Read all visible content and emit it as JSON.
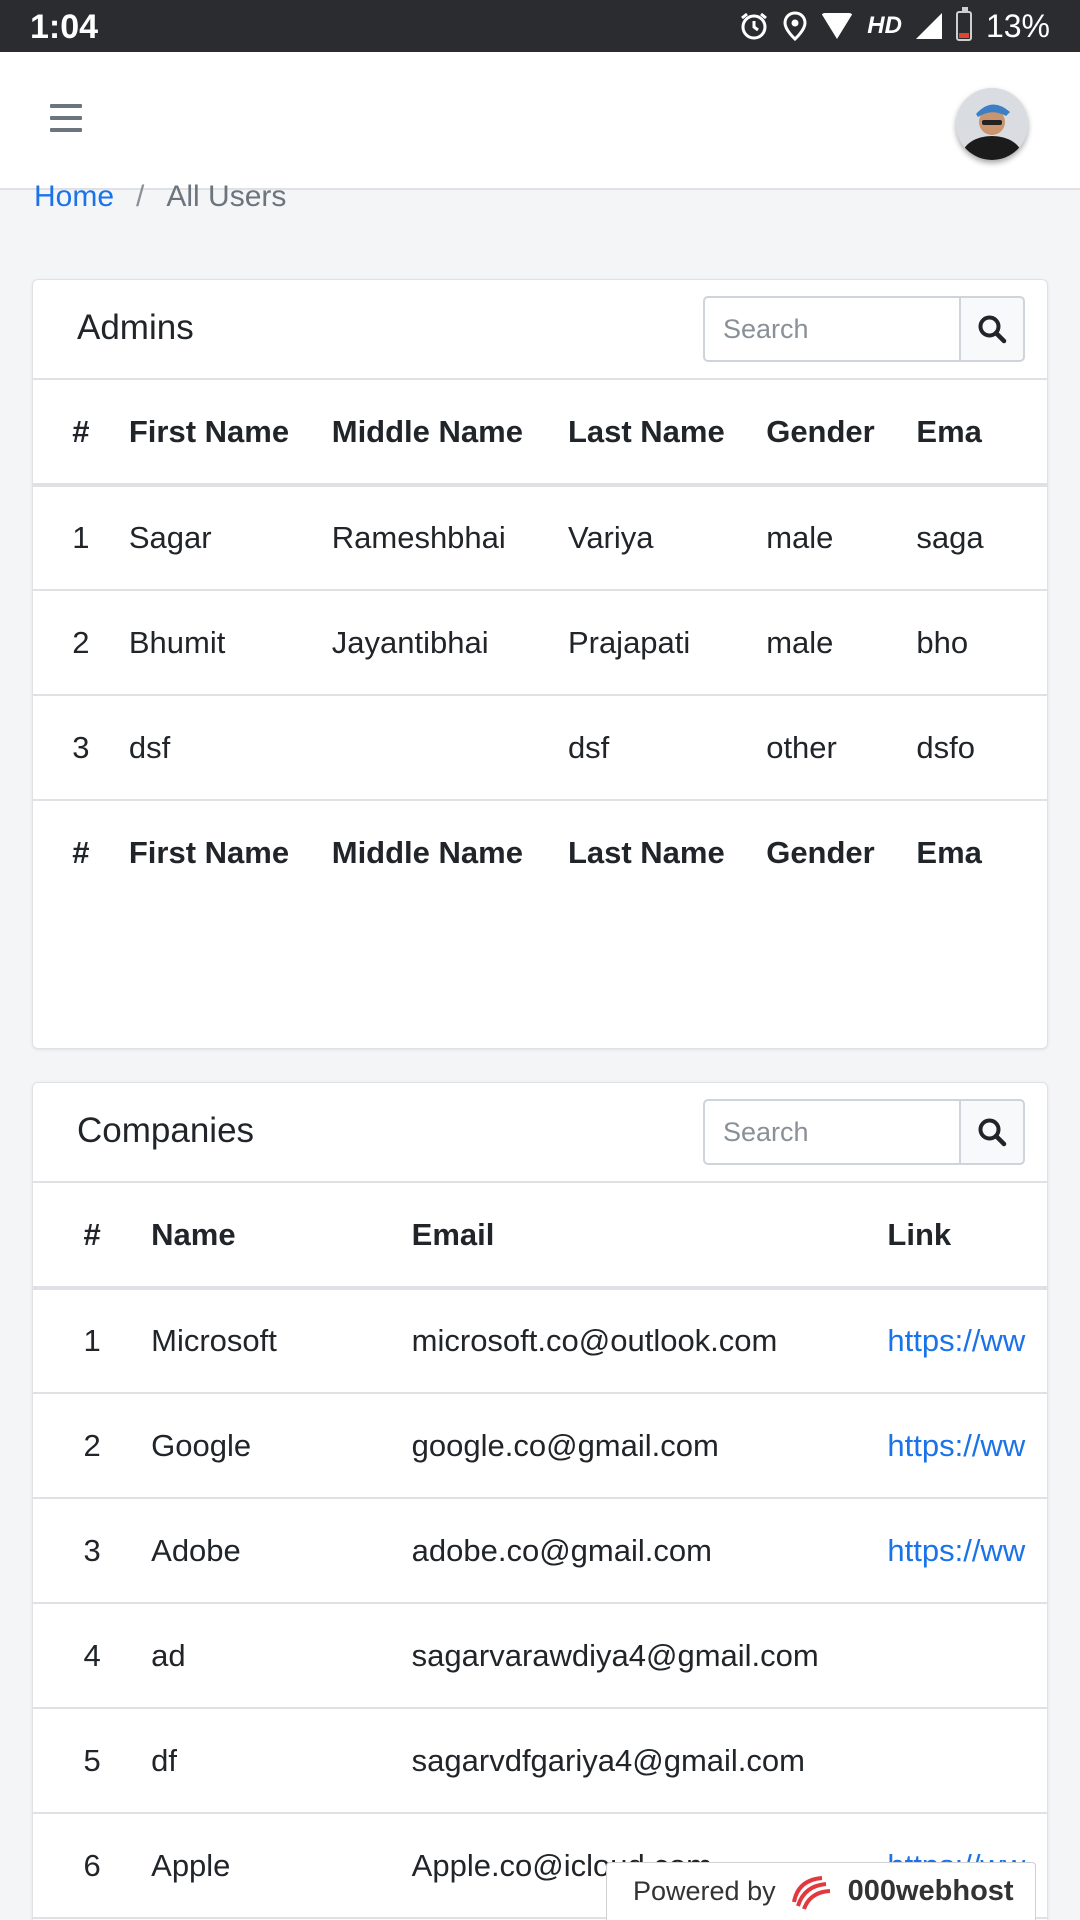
{
  "status_bar": {
    "time": "1:04",
    "network": "HD",
    "battery": "13%",
    "icons": [
      "alarm-icon",
      "location-icon",
      "wifi-icon",
      "signal-icon",
      "battery-icon"
    ]
  },
  "header": {
    "menu_icon": "hamburger-icon",
    "avatar": "user-avatar"
  },
  "breadcrumb": {
    "home": "Home",
    "separator": "/",
    "current": "All Users"
  },
  "admins": {
    "title": "Admins",
    "search_placeholder": "Search",
    "columns": [
      "#",
      "First Name",
      "Middle Name",
      "Last Name",
      "Gender",
      "Ema"
    ],
    "rows": [
      [
        "1",
        "Sagar",
        "Rameshbhai",
        "Variya",
        "male",
        "saga"
      ],
      [
        "2",
        "Bhumit",
        "Jayantibhai",
        "Prajapati",
        "male",
        "bho"
      ],
      [
        "3",
        "dsf",
        "",
        "dsf",
        "other",
        "dsfo"
      ]
    ],
    "footer_columns": [
      "#",
      "First Name",
      "Middle Name",
      "Last Name",
      "Gender",
      "Ema"
    ]
  },
  "companies": {
    "title": "Companies",
    "search_placeholder": "Search",
    "columns": [
      "#",
      "Name",
      "Email",
      "Link"
    ],
    "rows": [
      [
        "1",
        "Microsoft",
        "microsoft.co@outlook.com",
        "https://ww"
      ],
      [
        "2",
        "Google",
        "google.co@gmail.com",
        "https://ww"
      ],
      [
        "3",
        "Adobe",
        "adobe.co@gmail.com",
        "https://ww"
      ],
      [
        "4",
        "ad",
        "sagarvarawdiya4@gmail.com",
        ""
      ],
      [
        "5",
        "df",
        "sagarvdfgariya4@gmail.com",
        ""
      ],
      [
        "6",
        "Apple",
        "Apple.co@icloud.com",
        "https://ww"
      ]
    ]
  },
  "powered_by": {
    "label": "Powered by",
    "brand": "000webhost"
  },
  "colors": {
    "accent": "#1a73e8",
    "status_bar": "#2b2c30",
    "battery_low": "#e0452f",
    "brand_red": "#e03a3e"
  }
}
